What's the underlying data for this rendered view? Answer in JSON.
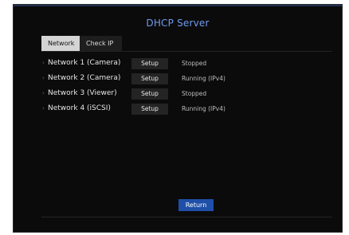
{
  "dialog": {
    "title": "DHCP Server"
  },
  "tabs": [
    {
      "label": "Network",
      "active": true
    },
    {
      "label": "Check IP",
      "active": false
    }
  ],
  "networks": [
    {
      "name": "Network 1 (Camera)",
      "button": "Setup",
      "status": "Stopped"
    },
    {
      "name": "Network 2 (Camera)",
      "button": "Setup",
      "status": "Running (IPv4)"
    },
    {
      "name": "Network 3 (Viewer)",
      "button": "Setup",
      "status": "Stopped"
    },
    {
      "name": "Network 4 (iSCSI)",
      "button": "Setup",
      "status": "Running (IPv4)"
    }
  ],
  "footer": {
    "return_label": "Return"
  },
  "colors": {
    "background": "#0b0b0b",
    "title": "#6f9cf0",
    "return_button": "#1f4fa8",
    "active_tab": "#d4d4d4"
  }
}
